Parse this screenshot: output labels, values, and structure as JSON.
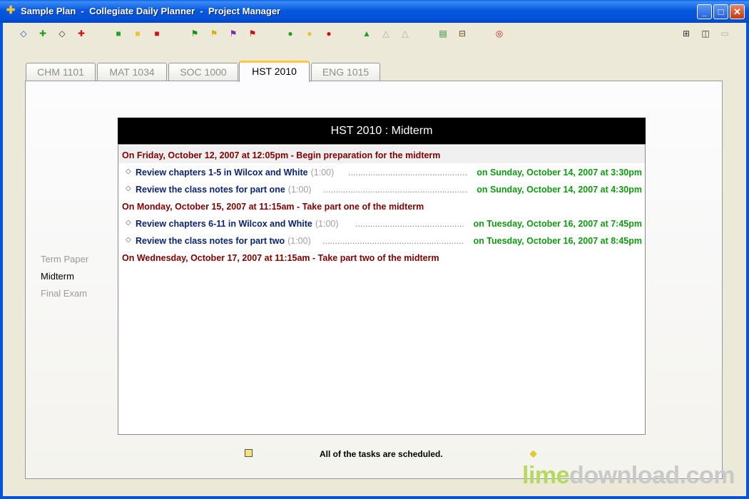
{
  "window": {
    "title": "Sample Plan  -  Collegiate Daily Planner  -  Project Manager",
    "buttons": {
      "minimize": "_",
      "maximize": "□",
      "close": "✕"
    }
  },
  "toolbar": {
    "icons": [
      {
        "name": "expand-icon",
        "glyph": "◇",
        "color": "#1a4fb5"
      },
      {
        "name": "add-green-icon",
        "glyph": "✚",
        "color": "#1fa31f"
      },
      {
        "name": "diamond-white-icon",
        "glyph": "◇",
        "color": "#333333"
      },
      {
        "name": "add-red-icon",
        "glyph": "✚",
        "color": "#d01010"
      },
      {
        "name": "folder-green-icon",
        "glyph": "■",
        "color": "#23a523"
      },
      {
        "name": "folder-yellow-icon",
        "glyph": "■",
        "color": "#e8c52c"
      },
      {
        "name": "folder-red-icon",
        "glyph": "■",
        "color": "#d01515"
      },
      {
        "name": "flag-green-icon",
        "glyph": "⚑",
        "color": "#149414"
      },
      {
        "name": "flag-yellow-icon",
        "glyph": "⚑",
        "color": "#d6b200"
      },
      {
        "name": "flag-purple-icon",
        "glyph": "⚑",
        "color": "#7a2ab0"
      },
      {
        "name": "flag-red-icon",
        "glyph": "⚑",
        "color": "#c01010"
      },
      {
        "name": "circle-green-icon",
        "glyph": "●",
        "color": "#1fa31f"
      },
      {
        "name": "circle-yellow-icon",
        "glyph": "●",
        "color": "#e8c52c"
      },
      {
        "name": "circle-red-icon",
        "glyph": "●",
        "color": "#c81414"
      },
      {
        "name": "triangle-green-icon",
        "glyph": "▲",
        "color": "#1fa31f"
      },
      {
        "name": "triangle-gray-icon",
        "glyph": "△",
        "color": "#a8a8a8"
      },
      {
        "name": "triangle-gray-2-icon",
        "glyph": "△",
        "color": "#a8a8a8"
      },
      {
        "name": "document-icon",
        "glyph": "▤",
        "color": "#2e8b2e"
      },
      {
        "name": "print-icon",
        "glyph": "⊟",
        "color": "#6b4a1e"
      },
      {
        "name": "help-lifebuoy-icon",
        "glyph": "◎",
        "color": "#c82020"
      },
      {
        "name": "grid-view-icon",
        "glyph": "⊞",
        "color": "#333333"
      },
      {
        "name": "split-view-icon",
        "glyph": "◫",
        "color": "#333333"
      },
      {
        "name": "folder-open-icon",
        "glyph": "▭",
        "color": "#b0b0b0"
      }
    ]
  },
  "tabs": [
    "CHM 1101",
    "MAT 1034",
    "SOC 1000",
    "HST 2010",
    "ENG 1015"
  ],
  "active_tab": 3,
  "sidebar": {
    "items": [
      {
        "label": "Term Paper",
        "state": "inactive"
      },
      {
        "label": "Midterm",
        "state": "selected"
      },
      {
        "label": "Final Exam",
        "state": "inactive"
      }
    ]
  },
  "main": {
    "header": "HST 2010 : Midterm",
    "rows": [
      {
        "kind": "milestone",
        "text": "On Friday, October 12, 2007 at 12:05pm - Begin preparation for the midterm"
      },
      {
        "kind": "task",
        "name": "Review chapters 1-5 in Wilcox and White",
        "duration": "(1:00)",
        "when": "on Sunday, October 14, 2007 at 3:30pm"
      },
      {
        "kind": "task",
        "name": "Review the class notes for part one",
        "duration": "(1:00)",
        "when": "on Sunday, October 14, 2007 at 4:30pm"
      },
      {
        "kind": "milestone",
        "text": "On Monday, October 15, 2007 at 11:15am - Take part one of the midterm"
      },
      {
        "kind": "task",
        "name": "Review chapters 6-11 in Wilcox and White",
        "duration": "(1:00)",
        "when": "on Tuesday, October 16, 2007 at 7:45pm"
      },
      {
        "kind": "task",
        "name": "Review the class notes for part two",
        "duration": "(1:00)",
        "when": "on Tuesday, October 16, 2007 at 8:45pm"
      },
      {
        "kind": "milestone",
        "text": "On Wednesday, October 17, 2007 at 11:15am - Take part two of the midterm"
      }
    ]
  },
  "status": {
    "text": "All of the tasks are scheduled."
  },
  "watermark": {
    "part1": "lime",
    "part2": "download.com"
  }
}
